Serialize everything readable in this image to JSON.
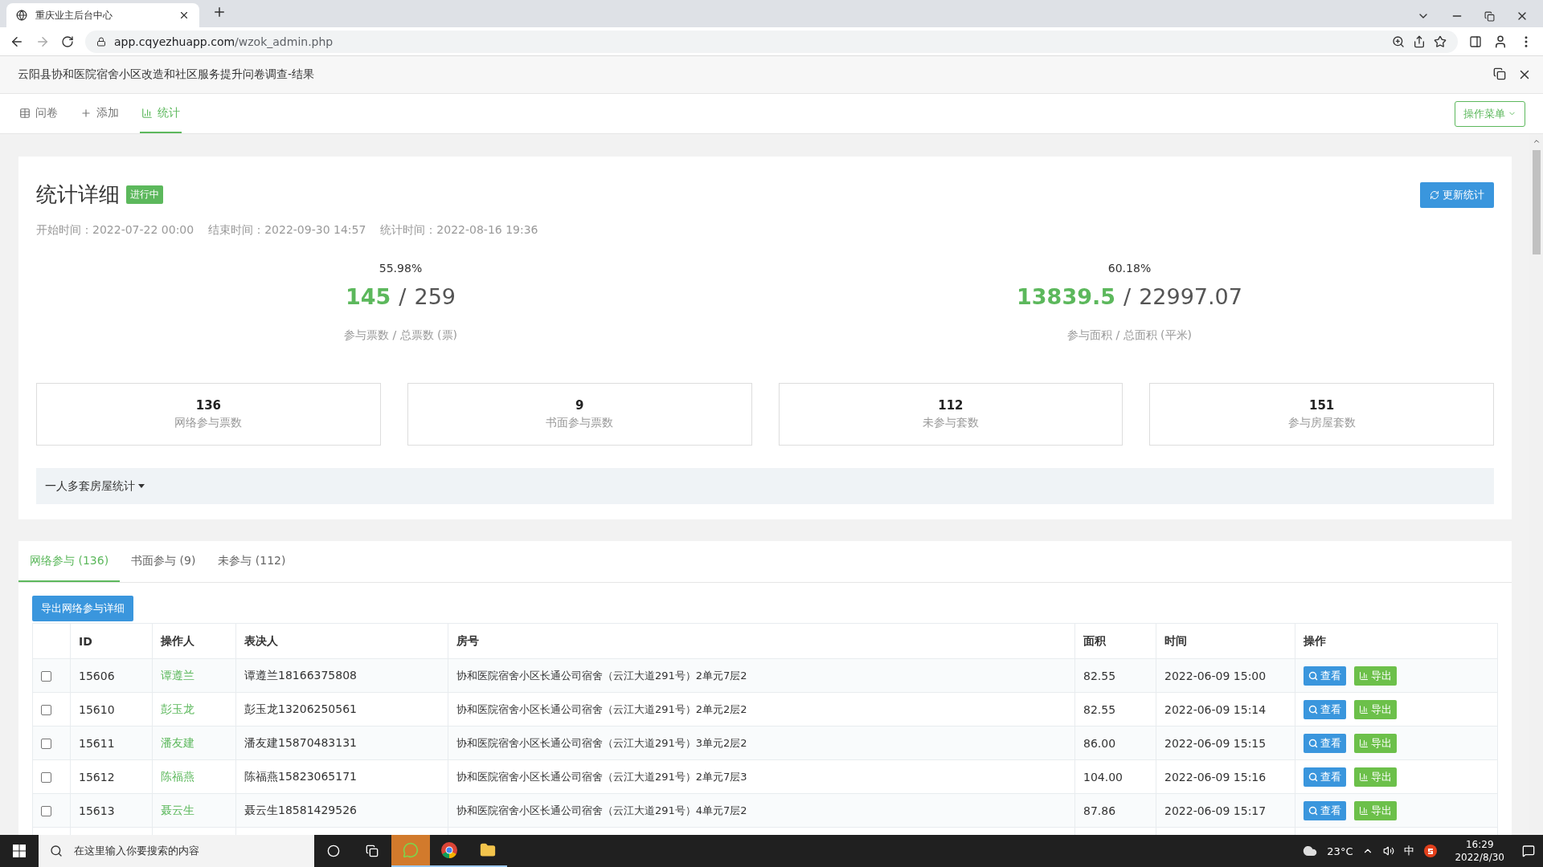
{
  "browser": {
    "tab_title": "重庆业主后台中心",
    "url_host": "app.cqyezhuapp.com",
    "url_path": "/wzok_admin.php"
  },
  "page_title": "云阳县协和医院宿舍小区改造和社区服务提升问卷调查-结果",
  "nav": [
    {
      "label": "问卷",
      "selected": false
    },
    {
      "label": "添加",
      "selected": false
    },
    {
      "label": "统计",
      "selected": true
    }
  ],
  "menu_button": "操作菜单",
  "stats": {
    "title": "统计详细",
    "status": "进行中",
    "refresh_button": "更新统计",
    "times": [
      "开始时间：2022-07-22 00:00",
      "结束时间：2022-09-30 14:57",
      "统计时间：2022-08-16 19:36"
    ],
    "summaries": [
      {
        "percent": "55.98%",
        "part": "145",
        "separator": "/",
        "total": "259",
        "caption": "参与票数 / 总票数 (票)"
      },
      {
        "percent": "60.18%",
        "part": "13839.5",
        "separator": "/",
        "total": "22997.07",
        "caption": "参与面积 / 总面积 (平米)"
      }
    ],
    "boxes": [
      {
        "value": "136",
        "label": "网络参与票数"
      },
      {
        "value": "9",
        "label": "书面参与票数"
      },
      {
        "value": "112",
        "label": "未参与套数"
      },
      {
        "value": "151",
        "label": "参与房屋套数"
      }
    ],
    "dropdown": "一人多套房屋统计"
  },
  "tabs": [
    {
      "label": "网络参与 (136)",
      "selected": true
    },
    {
      "label": "书面参与 (9)",
      "selected": false
    },
    {
      "label": "未参与 (112)",
      "selected": false
    }
  ],
  "export_button": "导出网络参与详细",
  "table": {
    "columns": [
      "ID",
      "操作人",
      "表决人",
      "房号",
      "面积",
      "时间",
      "操作"
    ],
    "rows": [
      {
        "checked": false,
        "id": "15606",
        "operator": "谭遵兰",
        "voter": "谭遵兰18166375808",
        "room": "协和医院宿舍小区长通公司宿舍（云江大道291号）2单元7层2",
        "area": "82.55",
        "time": "2022-06-09 15:00",
        "actions": [
          "查看",
          "导出"
        ]
      },
      {
        "checked": false,
        "id": "15610",
        "operator": "彭玉龙",
        "voter": "彭玉龙13206250561",
        "room": "协和医院宿舍小区长通公司宿舍（云江大道291号）2单元2层2",
        "area": "82.55",
        "time": "2022-06-09 15:14",
        "actions": [
          "查看",
          "导出"
        ]
      },
      {
        "checked": false,
        "id": "15611",
        "operator": "潘友建",
        "voter": "潘友建15870483131",
        "room": "协和医院宿舍小区长通公司宿舍（云江大道291号）3单元2层2",
        "area": "86.00",
        "time": "2022-06-09 15:15",
        "actions": [
          "查看",
          "导出"
        ]
      },
      {
        "checked": false,
        "id": "15612",
        "operator": "陈福燕",
        "voter": "陈福燕15823065171",
        "room": "协和医院宿舍小区长通公司宿舍（云江大道291号）2单元7层3",
        "area": "104.00",
        "time": "2022-06-09 15:16",
        "actions": [
          "查看",
          "导出"
        ]
      },
      {
        "checked": false,
        "id": "15613",
        "operator": "聂云生",
        "voter": "聂云生18581429526",
        "room": "协和医院宿舍小区长通公司宿舍（云江大道291号）4单元7层2",
        "area": "87.86",
        "time": "2022-06-09 15:17",
        "actions": [
          "查看",
          "导出"
        ]
      }
    ]
  },
  "taskbar": {
    "search_placeholder": "在这里输入你要搜索的内容",
    "temperature": "23°C",
    "ime": "中",
    "time": "16:29",
    "date": "2022/8/30"
  }
}
